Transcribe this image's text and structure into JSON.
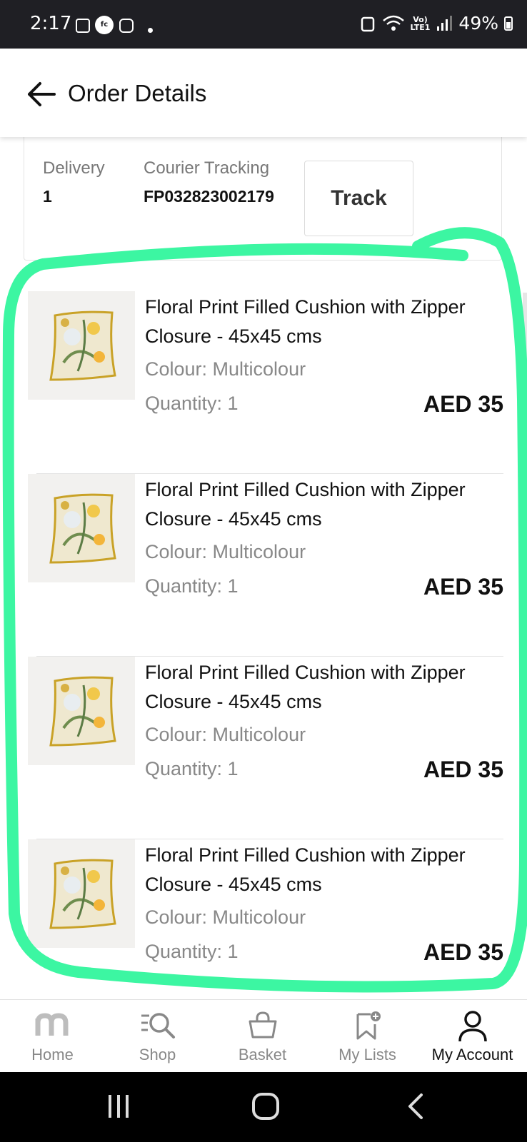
{
  "status_bar": {
    "time": "2:17",
    "notif_badge": "fc",
    "volte": "Vo)",
    "lte": "LTE1",
    "battery": "49%"
  },
  "header": {
    "title": "Order Details"
  },
  "delivery": {
    "delivery_label": "Delivery",
    "delivery_value": "1",
    "courier_label": "Courier Tracking",
    "courier_value": "FP032823002179",
    "track_label": "Track"
  },
  "items": [
    {
      "name": "Floral Print Filled Cushion with Zipper Closure - 45x45 cms",
      "colour": "Colour: Multicolour",
      "quantity": "Quantity: 1",
      "price": "AED 35"
    },
    {
      "name": "Floral Print Filled Cushion with Zipper Closure - 45x45 cms",
      "colour": "Colour: Multicolour",
      "quantity": "Quantity: 1",
      "price": "AED 35"
    },
    {
      "name": "Floral Print Filled Cushion with Zipper Closure - 45x45 cms",
      "colour": "Colour: Multicolour",
      "quantity": "Quantity: 1",
      "price": "AED 35"
    },
    {
      "name": "Floral Print Filled Cushion with Zipper Closure - 45x45 cms",
      "colour": "Colour: Multicolour",
      "quantity": "Quantity: 1",
      "price": "AED 35"
    }
  ],
  "bottom_nav": {
    "items": [
      {
        "label": "Home",
        "icon": "home-logo-icon"
      },
      {
        "label": "Shop",
        "icon": "shop-search-icon"
      },
      {
        "label": "Basket",
        "icon": "basket-icon"
      },
      {
        "label": "My Lists",
        "icon": "bookmark-add-icon"
      },
      {
        "label": "My Account",
        "icon": "account-icon"
      }
    ],
    "active_index": 4
  },
  "colors": {
    "annotation": "#3cf6a2",
    "status_bar_bg": "#1f1f24",
    "text_primary": "#111111",
    "text_muted": "#888888"
  }
}
